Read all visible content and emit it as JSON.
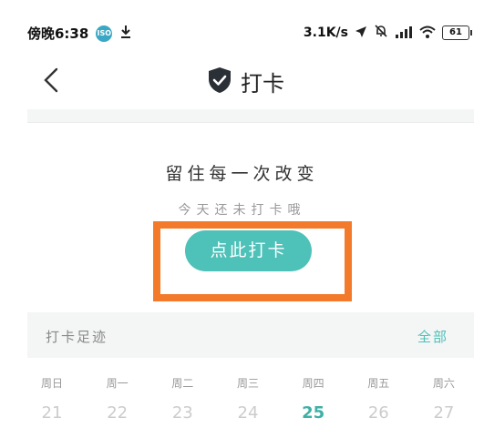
{
  "status_bar": {
    "time": "傍晚6:38",
    "app_icon_label": "ISO",
    "net_speed": "3.1K/s",
    "battery": "61"
  },
  "nav": {
    "title": "打卡"
  },
  "checkin": {
    "heading": "留住每一次改变",
    "status": "今天还未打卡哦",
    "button_label": "点此打卡"
  },
  "footprint": {
    "title": "打卡足迹",
    "all_label": "全部"
  },
  "week": [
    {
      "name": "周日",
      "num": "21"
    },
    {
      "name": "周一",
      "num": "22"
    },
    {
      "name": "周二",
      "num": "23"
    },
    {
      "name": "周三",
      "num": "24"
    },
    {
      "name": "周四",
      "num": "25"
    },
    {
      "name": "周五",
      "num": "26"
    },
    {
      "name": "周六",
      "num": "27"
    }
  ],
  "colors": {
    "accent": "#4ec1b8",
    "highlight": "#f47a2b",
    "today": "#3fb0a6"
  },
  "icons": [
    "download-icon",
    "location-arrow-icon",
    "mute-bell-icon",
    "signal-icon",
    "wifi-icon",
    "battery-icon",
    "back-chevron-icon",
    "shield-check-icon"
  ]
}
